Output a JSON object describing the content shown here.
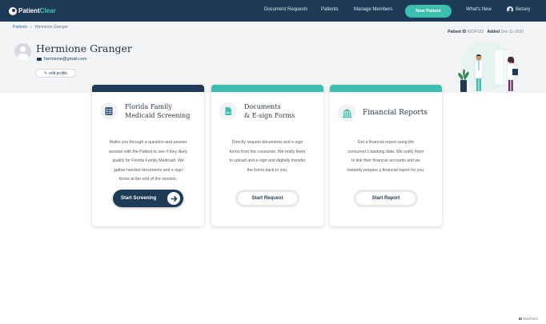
{
  "brand": {
    "name_a": "Patient",
    "name_b": "Clear"
  },
  "nav": {
    "links": [
      "Document Requests",
      "Patients",
      "Manage Members"
    ],
    "cta": "New Patient",
    "whats_new": "What's New",
    "user": "Betsey"
  },
  "breadcrumb": {
    "parent": "Patients",
    "separator": "›",
    "current": "Hermione Granger"
  },
  "patient": {
    "name": "Hermione Granger",
    "email": "hermione@gmail.com",
    "edit_label": "edit profile",
    "id_label": "Patient ID",
    "id_value": "60DF523",
    "added_label": "Added",
    "added_value": "Dec-11-2020"
  },
  "cards": [
    {
      "title_lines": [
        "Florida Family",
        "Medicaid Screening"
      ],
      "desc_lines": [
        "Walks you through a question-and-answer",
        "session with the Patient to see if they likely",
        "qualify for Florida Family Medicaid. We",
        "gather needed documents and e-sign",
        "forms at the end of the session."
      ],
      "button": "Start Screening",
      "icon": "checklist-icon",
      "accent": "#1d3a57"
    },
    {
      "title_lines": [
        "Documents",
        "& E-sign Forms"
      ],
      "desc_lines": [
        "Directly request documents and e-sign",
        "forms from the consumer. We notify them",
        "to upload and e-sign and digitally transfer",
        "the forms back to you."
      ],
      "button": "Start Request",
      "icon": "document-icon",
      "accent": "#3cbfae"
    },
    {
      "title_lines": [
        "Financial Reports"
      ],
      "desc_lines": [
        "Get a financial report using the",
        "consumer's banking data. We notify them",
        "to link their financial accounts and we",
        "instantly prepare a financial report for you."
      ],
      "button": "Start Report",
      "icon": "bank-icon",
      "accent": "#3cbfae"
    }
  ],
  "footer": {
    "id_label": "ID",
    "id_value": "60DF523"
  },
  "colors": {
    "navy": "#1d3a57",
    "teal": "#3cbfae",
    "background": "#f3f4f6"
  }
}
